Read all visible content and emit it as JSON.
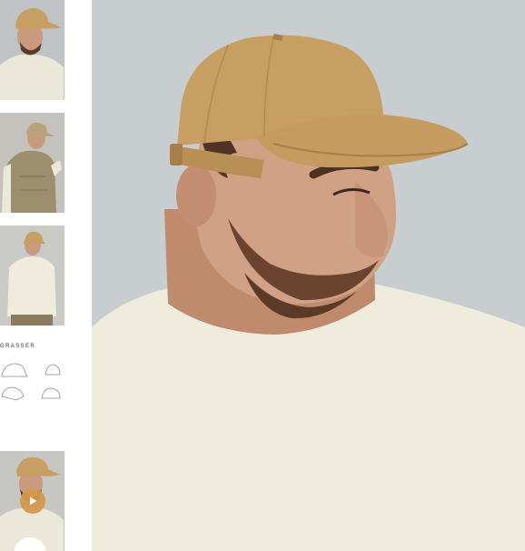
{
  "gallery": {
    "thumbnails": [
      {
        "view": "model-side"
      },
      {
        "view": "model-vest"
      },
      {
        "view": "model-back"
      },
      {
        "view": "size-guide",
        "label": "GRASSER"
      },
      {
        "view": "video"
      }
    ],
    "play_icon": "play-icon"
  },
  "hero": {
    "view": "model-side-closeup"
  },
  "colors": {
    "cap": "#c89f63",
    "sweater": "#efebdd",
    "background": "#c8cdd0",
    "play": "#d59a4c"
  }
}
